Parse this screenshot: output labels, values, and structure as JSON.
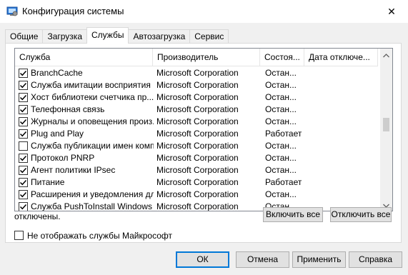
{
  "window": {
    "title": "Конфигурация системы",
    "close_glyph": "✕",
    "accent": "#0078d7"
  },
  "tabs": [
    {
      "label": "Общие",
      "active": false
    },
    {
      "label": "Загрузка",
      "active": false
    },
    {
      "label": "Службы",
      "active": true
    },
    {
      "label": "Автозагрузка",
      "active": false
    },
    {
      "label": "Сервис",
      "active": false
    }
  ],
  "services_list": {
    "columns": [
      "Служба",
      "Производитель",
      "Состоя...",
      "Дата отключе..."
    ],
    "rows": [
      {
        "checked": true,
        "name": "BranchCache",
        "manufacturer": "Microsoft Corporation",
        "status": "Остан..."
      },
      {
        "checked": true,
        "name": "Служба имитации восприятия ...",
        "manufacturer": "Microsoft Corporation",
        "status": "Остан..."
      },
      {
        "checked": true,
        "name": "Хост библиотеки счетчика пр...",
        "manufacturer": "Microsoft Corporation",
        "status": "Остан..."
      },
      {
        "checked": true,
        "name": "Телефонная связь",
        "manufacturer": "Microsoft Corporation",
        "status": "Остан..."
      },
      {
        "checked": true,
        "name": "Журналы и оповещения произ...",
        "manufacturer": "Microsoft Corporation",
        "status": "Остан..."
      },
      {
        "checked": true,
        "name": "Plug and Play",
        "manufacturer": "Microsoft Corporation",
        "status": "Работает"
      },
      {
        "checked": false,
        "name": "Служба публикации имен комп...",
        "manufacturer": "Microsoft Corporation",
        "status": "Остан..."
      },
      {
        "checked": true,
        "name": "Протокол PNRP",
        "manufacturer": "Microsoft Corporation",
        "status": "Остан..."
      },
      {
        "checked": true,
        "name": "Агент политики IPsec",
        "manufacturer": "Microsoft Corporation",
        "status": "Остан..."
      },
      {
        "checked": true,
        "name": "Питание",
        "manufacturer": "Microsoft Corporation",
        "status": "Работает"
      },
      {
        "checked": true,
        "name": "Расширения и уведомления дл...",
        "manufacturer": "Microsoft Corporation",
        "status": "Остан..."
      },
      {
        "checked": true,
        "name": "Служба PushToInstall Windows",
        "manufacturer": "Microsoft Corporation",
        "status": "Остан..."
      }
    ]
  },
  "note": "отключены.",
  "buttons": {
    "enable_all": "Включить все",
    "disable_all": "Отключить все",
    "ok": "ОК",
    "cancel": "Отмена",
    "apply": "Применить",
    "help": "Справка"
  },
  "hide_ms": {
    "label": "Не отображать службы Майкрософт",
    "checked": false
  }
}
